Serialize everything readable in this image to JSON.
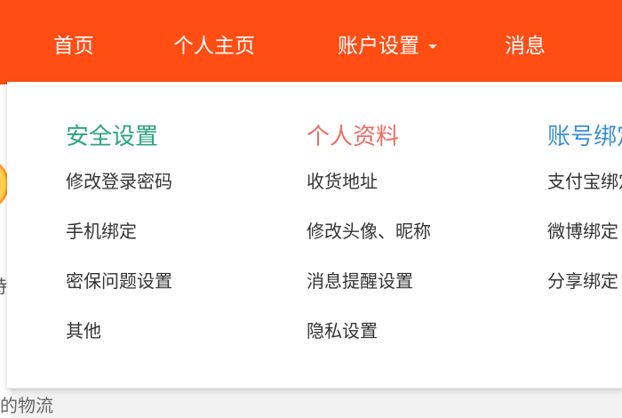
{
  "nav": {
    "items": [
      {
        "label": "首页"
      },
      {
        "label": "个人主页"
      },
      {
        "label": "账户设置"
      },
      {
        "label": "消息"
      }
    ]
  },
  "colors": {
    "nav_bg": "#ff4d14",
    "security_heading": "#2aa57d",
    "profile_heading": "#ee6b63",
    "binding_heading": "#3b8fd1"
  },
  "dropdown": {
    "columns": [
      {
        "heading": "安全设置",
        "items": [
          "修改登录密码",
          "手机绑定",
          "密保问题设置",
          "其他"
        ]
      },
      {
        "heading": "个人资料",
        "items": [
          "收货地址",
          "修改头像、昵称",
          "消息提醒设置",
          "隐私设置"
        ]
      },
      {
        "heading": "账号绑定",
        "items": [
          "支付宝绑定",
          "微博绑定",
          "分享绑定"
        ]
      }
    ]
  },
  "background": {
    "left_partial_text": "特",
    "bottom_partial_text": "的物流"
  }
}
